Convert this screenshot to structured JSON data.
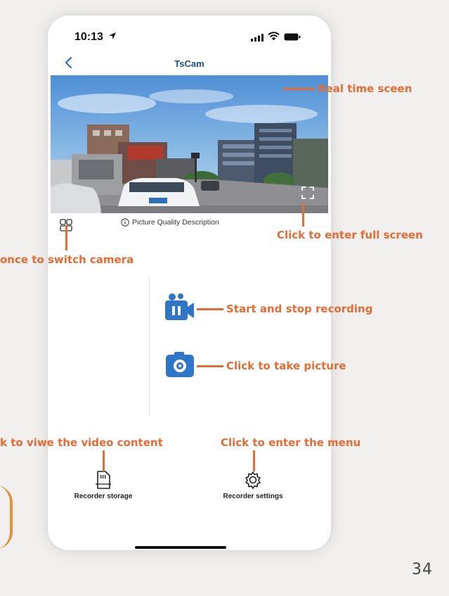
{
  "status_bar": {
    "time": "10:13"
  },
  "nav": {
    "title": "TsCam"
  },
  "video": {
    "quality_description": "Picture Quality Description"
  },
  "bottom": {
    "storage_label": "Recorder storage",
    "settings_label": "Recorder settings"
  },
  "annotations": {
    "real_time": "Real time sceen",
    "full_screen": "Click to enter full screen",
    "switch_camera": "once to switch camera",
    "recording": "Start and stop recording",
    "picture": "Click to take picture",
    "video_content": "k to viwe the video content",
    "menu": "Click to enter the menu"
  },
  "page_number": "34",
  "colors": {
    "accent": "#e46c35",
    "title": "#1f4e8c",
    "button_blue": "#2f76c9"
  },
  "icons": [
    "location-arrow-icon",
    "signal-icon",
    "wifi-icon",
    "battery-icon",
    "back-chevron-icon",
    "fullscreen-icon",
    "switch-camera-icon",
    "info-icon",
    "record-video-icon",
    "camera-icon",
    "sd-card-icon",
    "gear-icon"
  ]
}
